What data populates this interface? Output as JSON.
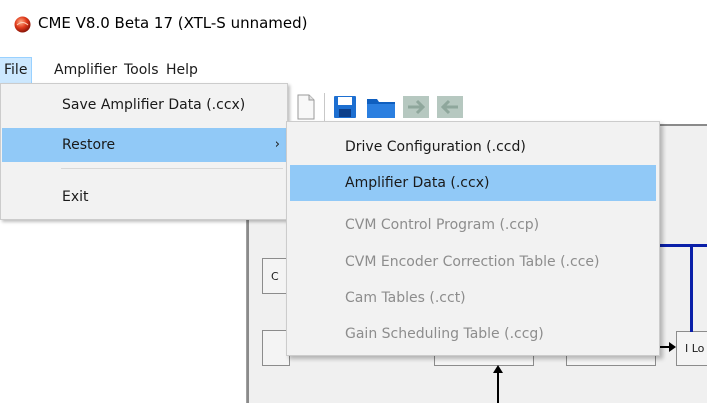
{
  "window": {
    "title": "CME V8.0 Beta 17 (XTL-S unnamed)",
    "app_icon": "red-sphere-icon"
  },
  "menubar": {
    "items": [
      "File",
      "Amplifier",
      "Tools",
      "Help"
    ],
    "active": "File"
  },
  "file_menu": {
    "items": [
      {
        "label": "Save Amplifier Data (.ccx)"
      },
      {
        "label": "Restore",
        "has_submenu": true,
        "highlighted": true
      },
      {
        "label": "Exit"
      }
    ]
  },
  "restore_submenu": {
    "items": [
      {
        "label": "Drive Configuration (.ccd)",
        "enabled": true
      },
      {
        "label": "Amplifier Data (.ccx)",
        "enabled": true,
        "highlighted": true
      },
      {
        "label": "CVM Control Program (.ccp)",
        "enabled": false
      },
      {
        "label": "CVM Encoder Correction Table (.cce)",
        "enabled": false
      },
      {
        "label": "Cam Tables (.cct)",
        "enabled": false
      },
      {
        "label": "Gain Scheduling Table (.ccg)",
        "enabled": false
      }
    ]
  },
  "background": {
    "partial_box_1": "C",
    "partial_box_2": "I Lo"
  },
  "toolbar": {
    "icons": [
      "document-icon",
      "save-disk-icon",
      "folder-icon",
      "arrow-right-icon",
      "arrow-left-icon"
    ]
  },
  "colors": {
    "highlight": "#91c9f7",
    "menu_bg": "#f2f2f2",
    "disabled_text": "#8d8d8d",
    "diagram_line": "#0a1fa8"
  }
}
